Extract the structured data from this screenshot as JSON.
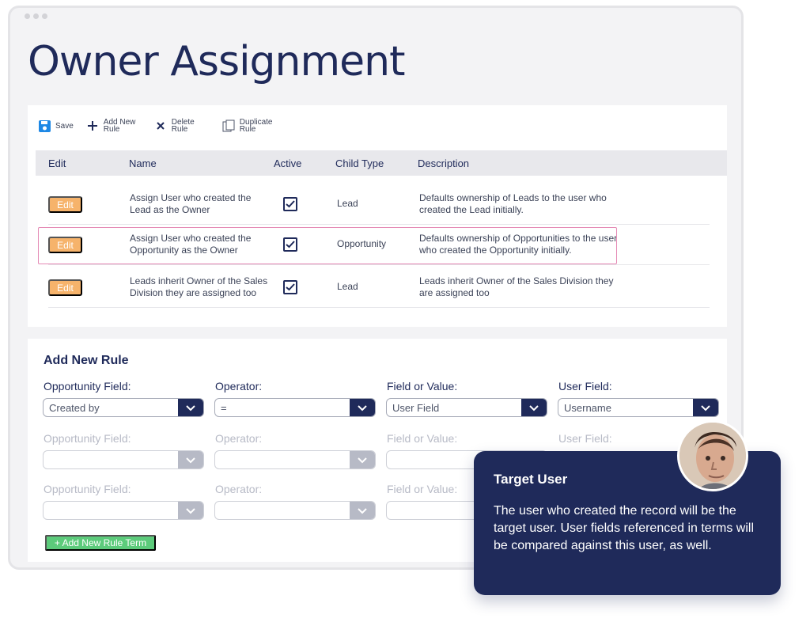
{
  "page": {
    "title": "Owner Assignment"
  },
  "toolbar": {
    "save": "Save",
    "add_new_rule": "Add New Rule",
    "delete_rule": "Delete Rule",
    "duplicate_rule": "Duplicate Rule"
  },
  "table": {
    "headers": {
      "edit": "Edit",
      "name": "Name",
      "active": "Active",
      "child_type": "Child Type",
      "description": "Description"
    },
    "rows": [
      {
        "edit": "Edit",
        "name": "Assign User who created the Lead as the Owner",
        "active": true,
        "child_type": "Lead",
        "description": "Defaults ownership of Leads to the user who created the Lead initially."
      },
      {
        "edit": "Edit",
        "name": "Assign User who created the Opportunity as the Owner",
        "active": true,
        "child_type": "Opportunity",
        "description": "Defaults ownership of Opportunities to the user who created the Opportunity initially."
      },
      {
        "edit": "Edit",
        "name": "Leads inherit Owner of the Sales Division they are assigned too",
        "active": true,
        "child_type": "Lead",
        "description": "Leads inherit Owner of the Sales Division they are assigned too"
      }
    ]
  },
  "rule_form": {
    "title": "Add New Rule",
    "labels": {
      "opportunity_field": "Opportunity Field:",
      "operator": "Operator:",
      "field_or_value": "Field or Value:",
      "user_field": "User Field:"
    },
    "values": {
      "opportunity_field": "Created by",
      "operator": "=",
      "field_or_value": "User Field",
      "user_field": "Username"
    },
    "add_term": "+ Add New Rule Term"
  },
  "tooltip": {
    "title": "Target User",
    "body": "The user who created the record will be the target user. User fields referenced in terms will be compared against this user, as well."
  }
}
